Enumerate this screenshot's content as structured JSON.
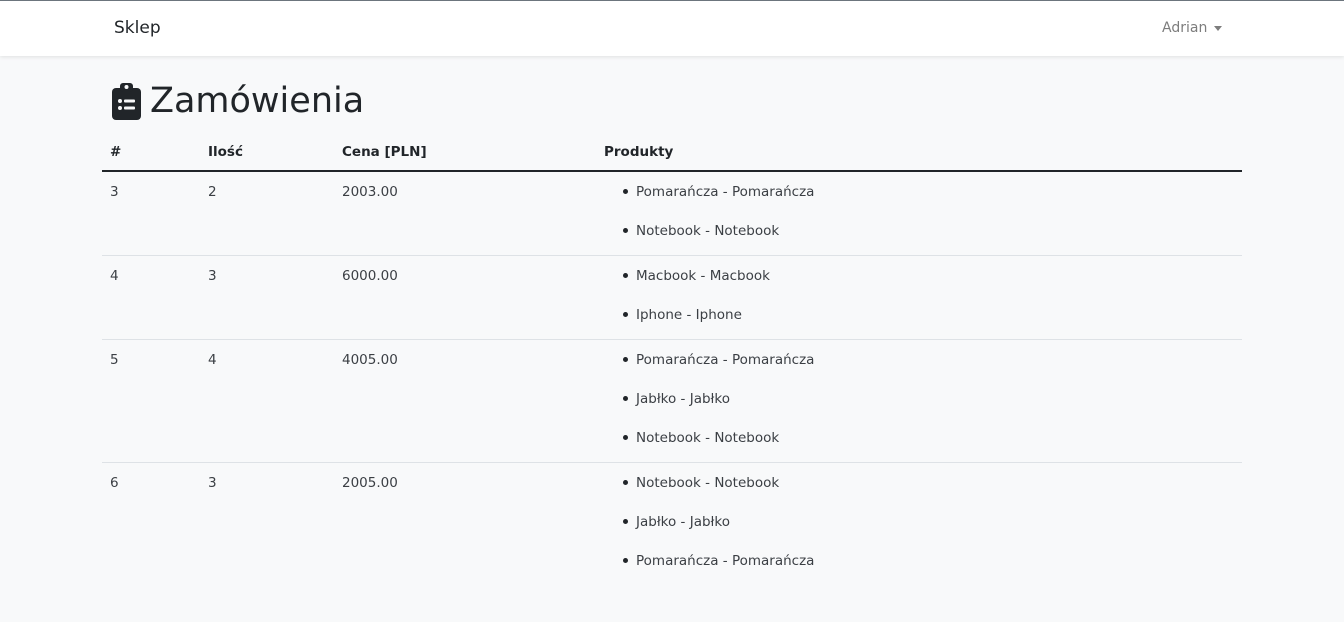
{
  "navbar": {
    "brand": "Sklep",
    "user": "Adrian"
  },
  "page": {
    "title": "Zamówienia",
    "icon": "clipboard-list-icon"
  },
  "table": {
    "headers": [
      "#",
      "Ilość",
      "Cena [PLN]",
      "Produkty"
    ],
    "rows": [
      {
        "id": "3",
        "qty": "2",
        "price": "2003.00",
        "products": [
          "Pomarańcza - Pomarańcza",
          "Notebook - Notebook"
        ]
      },
      {
        "id": "4",
        "qty": "3",
        "price": "6000.00",
        "products": [
          "Macbook - Macbook",
          "Iphone - Iphone"
        ]
      },
      {
        "id": "5",
        "qty": "4",
        "price": "4005.00",
        "products": [
          "Pomarańcza - Pomarańcza",
          "Jabłko - Jabłko",
          "Notebook - Notebook"
        ]
      },
      {
        "id": "6",
        "qty": "3",
        "price": "2005.00",
        "products": [
          "Notebook - Notebook",
          "Jabłko - Jabłko",
          "Pomarańcza - Pomarańcza"
        ]
      }
    ]
  }
}
